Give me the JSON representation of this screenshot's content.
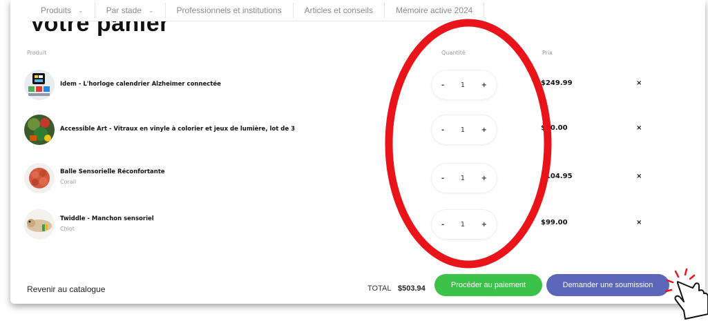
{
  "nav": {
    "items": [
      {
        "label": "Produits",
        "has_dropdown": true
      },
      {
        "label": "Par stade",
        "has_dropdown": true
      },
      {
        "label": "Professionnels et institutions",
        "has_dropdown": false
      },
      {
        "label": "Articles et conseils",
        "has_dropdown": false
      },
      {
        "label": "Mémoire active 2024",
        "has_dropdown": false
      }
    ]
  },
  "page": {
    "title": "Votre panier"
  },
  "cart": {
    "headers": {
      "product": "Produit",
      "quantity": "Quantité",
      "price": "Prix"
    },
    "items": [
      {
        "name": "Idem - L'horloge calendrier Alzheimer connectée",
        "variant": "",
        "quantity": "1",
        "minus": "-",
        "plus": "+",
        "price": "$249.99",
        "remove": "×",
        "thumb_icon": "clock-calendar-icon"
      },
      {
        "name": "Accessible Art - Vitraux en vinyle à colorier et jeux de lumière, lot de 3",
        "variant": "",
        "quantity": "1",
        "minus": "-",
        "plus": "+",
        "price": "$50.00",
        "remove": "×",
        "thumb_icon": "stained-glass-art-icon"
      },
      {
        "name": "Balle Sensorielle Réconfortante",
        "variant": "Corail",
        "quantity": "1",
        "minus": "-",
        "plus": "+",
        "price": "$104.95",
        "remove": "×",
        "thumb_icon": "sensory-ball-icon"
      },
      {
        "name": "Twiddle - Manchon sensoriel",
        "variant": "Chiot",
        "quantity": "1",
        "minus": "-",
        "plus": "+",
        "price": "$99.00",
        "remove": "×",
        "thumb_icon": "plush-muff-icon"
      }
    ]
  },
  "footer": {
    "back_link": "Revenir au catalogue",
    "total_label": "TOTAL",
    "total_value": "$503.94",
    "pay_button": "Procéder au paiement",
    "quote_button": "Demander une soumission"
  },
  "colors": {
    "pay_button": "#3cc24a",
    "quote_button": "#5b67b8",
    "annotation": "#e8141a"
  },
  "annotations": {
    "highlight": "red-ellipse-around-quantity-column",
    "pointer": "hand-cursor-icon"
  }
}
